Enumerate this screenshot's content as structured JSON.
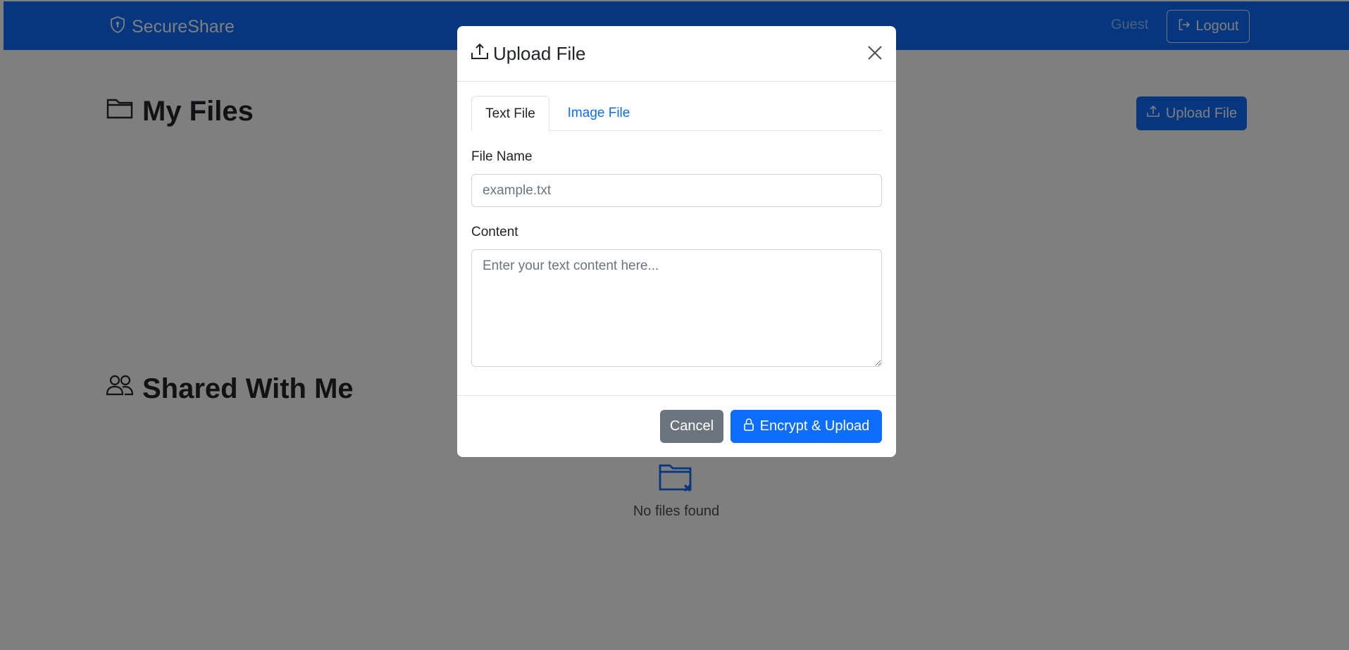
{
  "navbar": {
    "brand": "SecureShare",
    "brand_icon": "shield-icon",
    "user": "Guest",
    "logout_label": "Logout",
    "logout_icon": "logout-icon"
  },
  "main": {
    "my_files_title": "My Files",
    "my_files_icon": "folder-icon",
    "upload_button_label": "Upload File",
    "upload_icon": "upload-icon",
    "shared_title": "Shared With Me",
    "shared_icon": "people-icon",
    "empty_text": "No files found",
    "empty_icon": "folder-x-icon"
  },
  "modal": {
    "title": "Upload File",
    "title_icon": "upload-icon",
    "close_icon": "close-icon",
    "tabs": [
      {
        "label": "Text File",
        "active": true
      },
      {
        "label": "Image File",
        "active": false
      }
    ],
    "file_name_label": "File Name",
    "file_name_value": "",
    "file_name_placeholder": "example.txt",
    "content_label": "Content",
    "content_value": "",
    "content_placeholder": "Enter your text content here...",
    "cancel_label": "Cancel",
    "submit_label": "Encrypt & Upload",
    "submit_icon": "lock-icon"
  },
  "colors": {
    "primary": "#0d6efd",
    "secondary": "#6c757d",
    "backdrop": "rgba(0,0,0,0.5)"
  }
}
